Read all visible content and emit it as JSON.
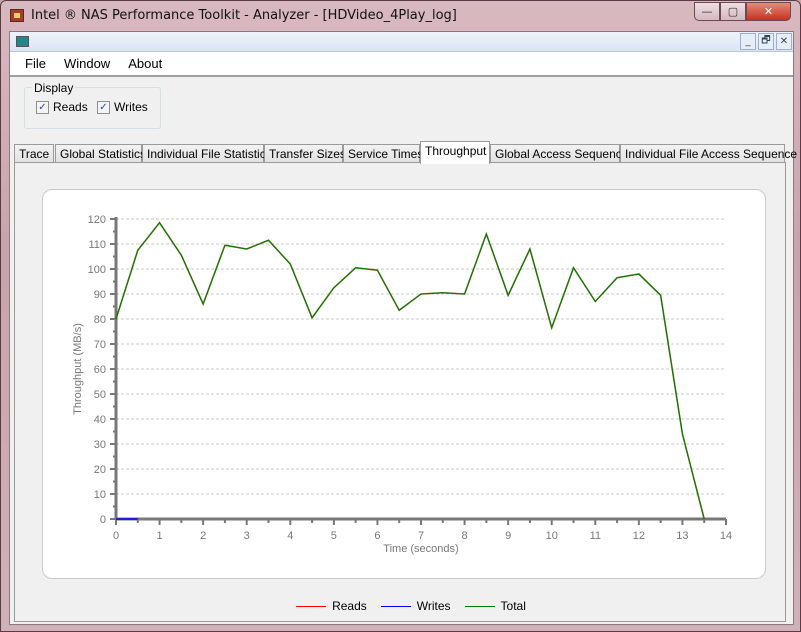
{
  "window": {
    "title": "Intel ® NAS Performance Toolkit - Analyzer - [HDVideo_4Play_log]",
    "min": "—",
    "max": "▢",
    "close": "✕"
  },
  "mdi": {
    "min": "_",
    "restore": "🗗",
    "close": "✕"
  },
  "menu": [
    "File",
    "Window",
    "About"
  ],
  "display": {
    "label": "Display",
    "reads": {
      "label": "Reads",
      "checked": true
    },
    "writes": {
      "label": "Writes",
      "checked": true
    },
    "check": "✓"
  },
  "tabs": [
    "Trace",
    "Global Statistics",
    "Individual File Statistics",
    "Transfer Sizes",
    "Service Times",
    "Throughput",
    "Global Access Sequence",
    "Individual File Access Sequence"
  ],
  "selected_tab": "Throughput",
  "chart_data": {
    "type": "line",
    "xlabel": "Time (seconds)",
    "ylabel": "Throughput (MB/s)",
    "xlim": [
      0,
      14
    ],
    "ylim": [
      0,
      120
    ],
    "xticks": [
      0,
      1,
      2,
      3,
      4,
      5,
      6,
      7,
      8,
      9,
      10,
      11,
      12,
      13,
      14
    ],
    "yticks": [
      0,
      10,
      20,
      30,
      40,
      50,
      60,
      70,
      80,
      90,
      100,
      110,
      120
    ],
    "grid": "horizontal dashed",
    "legend_position": "bottom",
    "series": [
      {
        "name": "Reads",
        "color": "#ff0000",
        "x": [
          0,
          0.5,
          1,
          1.5,
          2,
          2.5,
          3,
          3.5,
          4,
          4.5,
          5,
          5.5,
          6,
          6.5,
          7,
          7.5,
          8,
          8.5,
          9,
          9.5,
          10,
          10.5,
          11,
          11.5,
          12,
          12.5,
          13,
          13.5
        ],
        "y": [
          80,
          107.5,
          118.5,
          105.5,
          86,
          109.5,
          108,
          111.5,
          102,
          80.5,
          92.5,
          100.5,
          99.5,
          83.5,
          90,
          90.5,
          90,
          114,
          89.5,
          108,
          76.5,
          100.5,
          87,
          96.5,
          98,
          89.5,
          34,
          0
        ]
      },
      {
        "name": "Writes",
        "color": "#0000ff",
        "x": [
          0,
          0.5
        ],
        "y": [
          0,
          0
        ]
      },
      {
        "name": "Total",
        "color": "#008000",
        "x": [
          0,
          0.5,
          1,
          1.5,
          2,
          2.5,
          3,
          3.5,
          4,
          4.5,
          5,
          5.5,
          6,
          6.5,
          7,
          7.5,
          8,
          8.5,
          9,
          9.5,
          10,
          10.5,
          11,
          11.5,
          12,
          12.5,
          13,
          13.5
        ],
        "y": [
          80,
          107.5,
          118.5,
          105.5,
          86,
          109.5,
          108,
          111.5,
          102,
          80.5,
          92.5,
          100.5,
          99.5,
          83.5,
          90,
          90.5,
          90,
          114,
          89.5,
          108,
          76.5,
          100.5,
          87,
          96.5,
          98,
          89.5,
          34,
          0
        ]
      }
    ]
  }
}
